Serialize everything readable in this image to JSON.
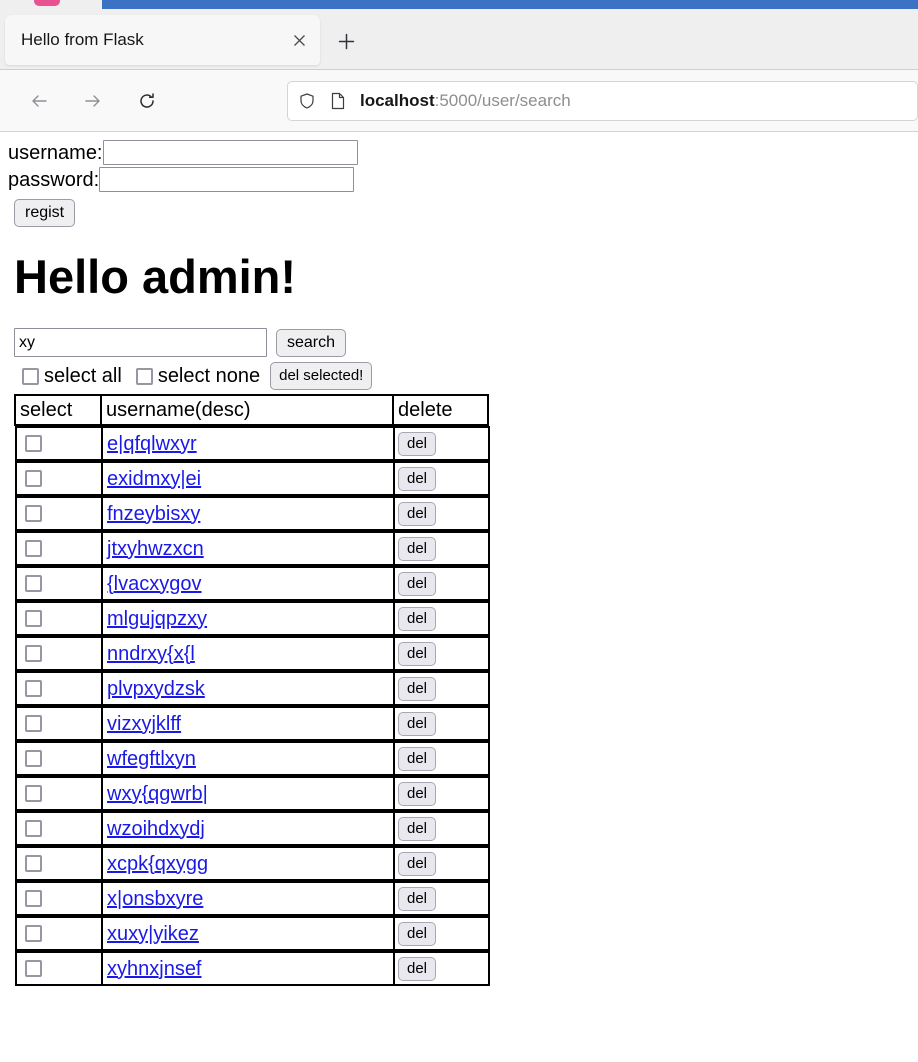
{
  "browser": {
    "tab": {
      "title": "Hello from Flask",
      "close_icon": "close-icon"
    },
    "new_tab_icon": "plus-icon",
    "nav": {
      "back_icon": "arrow-left-icon",
      "forward_icon": "arrow-right-icon",
      "reload_icon": "reload-icon"
    },
    "urlbar": {
      "shield_icon": "shield-icon",
      "page_icon": "page-icon",
      "host": "localhost",
      "path": ":5000/user/search"
    }
  },
  "register_form": {
    "username_label": "username:",
    "username_value": "",
    "username_placeholder": "",
    "password_label": "password:",
    "password_value": "",
    "password_placeholder": "",
    "submit_label": "regist"
  },
  "heading": "Hello admin!",
  "search": {
    "value": "xy",
    "placeholder": "",
    "button_label": "search"
  },
  "bulk_actions": {
    "select_all_label": "select all",
    "select_none_label": "select none",
    "delete_selected_label": "del selected!"
  },
  "table": {
    "headers": [
      "select",
      "username(desc)",
      "delete"
    ],
    "delete_button_label": "del",
    "rows": [
      {
        "username": "e|qfqlwxyr",
        "selected": false
      },
      {
        "username": "exidmxy|ei",
        "selected": false
      },
      {
        "username": "fnzeybisxy",
        "selected": false
      },
      {
        "username": "jtxyhwzxcn",
        "selected": false
      },
      {
        "username": "{lvacxygov",
        "selected": false
      },
      {
        "username": "mlgujqpzxy",
        "selected": false
      },
      {
        "username": "nndrxy{x{l",
        "selected": false
      },
      {
        "username": "plvpxydzsk",
        "selected": false
      },
      {
        "username": "vizxyjklff",
        "selected": false
      },
      {
        "username": "wfegftlxyn",
        "selected": false
      },
      {
        "username": "wxy{qgwrb|",
        "selected": false
      },
      {
        "username": "wzoihdxydj",
        "selected": false
      },
      {
        "username": "xcpk{qxygg",
        "selected": false
      },
      {
        "username": "x|onsbxyre",
        "selected": false
      },
      {
        "username": "xuxy|yikez",
        "selected": false
      },
      {
        "username": "xyhnxjnsef",
        "selected": false
      }
    ]
  },
  "colors": {
    "titlebar": "#3b72c4",
    "link": "#1a1ae6",
    "chrome_bg": "#f0efef"
  }
}
